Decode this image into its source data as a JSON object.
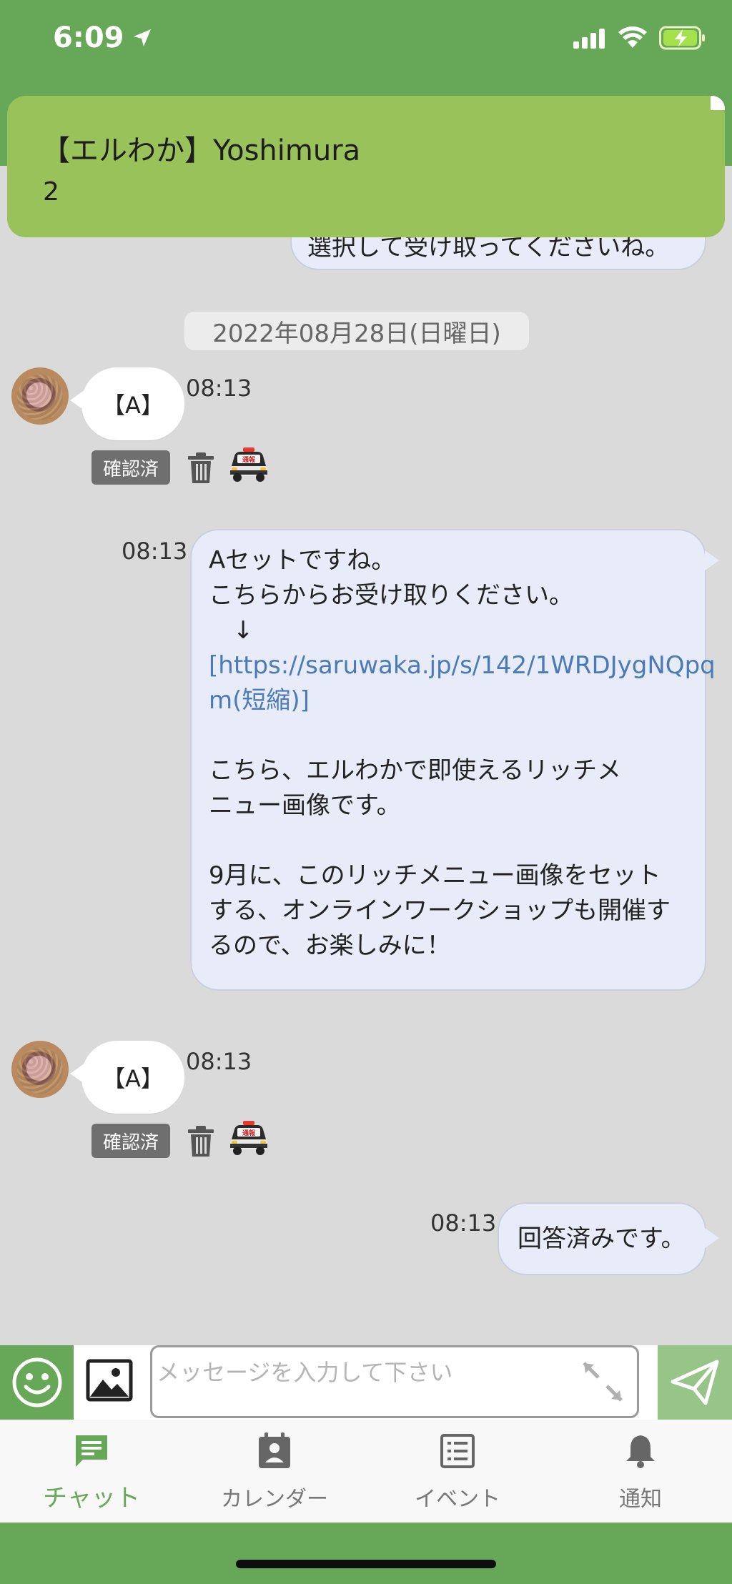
{
  "status_bar": {
    "time": "6:09"
  },
  "notification": {
    "title": "【エルわか】Yoshimura",
    "body": "2"
  },
  "chat": {
    "partial_message": "選択して受け取ってくださいね。",
    "date_separator": "2022年08月28日(日曜日)",
    "messages": [
      {
        "side": "left",
        "text": "【A】",
        "time": "08:13",
        "badge": "確認済",
        "car_label": "通報"
      },
      {
        "side": "right",
        "time": "08:13",
        "lines": [
          "Aセットですね。",
          "こちらからお受け取りください。",
          "　↓",
          "[https://saruwaka.jp/s/142/1WRDJygNQpq",
          "m(短縮)]",
          "",
          "こちら、エルわかで即使えるリッチメ",
          "ニュー画像です。",
          "",
          "9月に、このリッチメニュー画像をセット",
          "する、オンラインワークショップも開催す",
          "るので、お楽しみに！"
        ]
      },
      {
        "side": "left",
        "text": "【A】",
        "time": "08:13",
        "badge": "確認済",
        "car_label": "通報"
      },
      {
        "side": "right",
        "text": "回答済みです。",
        "time": "08:13"
      }
    ]
  },
  "input": {
    "placeholder": "メッセージを入力して下さい"
  },
  "tabs": [
    {
      "label": "チャット",
      "active": true
    },
    {
      "label": "カレンダー",
      "active": false
    },
    {
      "label": "イベント",
      "active": false
    },
    {
      "label": "通知",
      "active": false
    }
  ],
  "colors": {
    "brand_green": "#66a857",
    "banner_green": "#99c25a",
    "bubble_blue": "#e8ecf8",
    "link": "#4a7ab8"
  }
}
